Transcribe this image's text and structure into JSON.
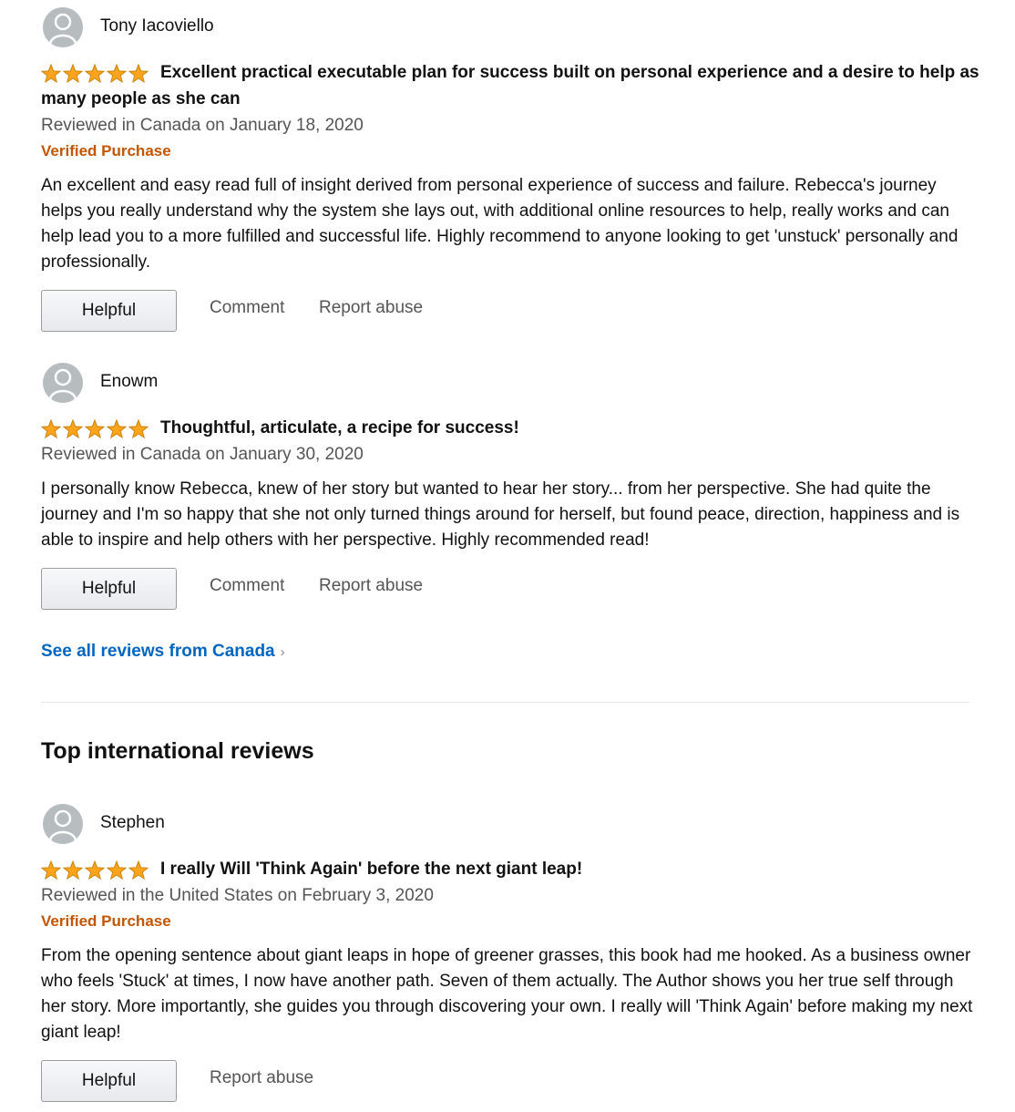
{
  "reviews": [
    {
      "profile_name": "Tony Iacoviello",
      "rating": 5,
      "title": "Excellent practical executable plan for success built on personal experience and a desire to help as many people as she can",
      "date": "Reviewed in Canada on January 18, 2020",
      "verified": "Verified Purchase",
      "body": "An excellent and easy read full of insight derived from personal experience of success and failure. Rebecca's journey helps you really understand why the system she lays out, with additional online resources to help, really works and can help lead you to a more fulfilled and successful life. Highly recommend to anyone looking to get 'unstuck' personally and professionally.",
      "helpful_label": "Helpful",
      "comment_label": "Comment",
      "report_label": "Report abuse"
    },
    {
      "profile_name": "Enowm",
      "rating": 5,
      "title": "Thoughtful, articulate, a recipe for success!",
      "date": "Reviewed in Canada on January 30, 2020",
      "body": "I personally know Rebecca, knew of her story but wanted to hear her story... from her perspective. She had quite the journey and I'm so happy that she not only turned things around for herself, but found peace, direction, happiness and is able to inspire and help others with her perspective. Highly recommended read!",
      "helpful_label": "Helpful",
      "comment_label": "Comment",
      "report_label": "Report abuse"
    },
    {
      "profile_name": "Stephen",
      "rating": 5,
      "title": "I really Will 'Think Again' before the next giant leap!",
      "date": "Reviewed in the United States on February 3, 2020",
      "verified": "Verified Purchase",
      "body": "From the opening sentence about giant leaps in hope of greener grasses, this book had me hooked. As a business owner who feels 'Stuck' at times, I now have another path. Seven of them actually. The Author shows you her true self through her story. More importantly, she guides you through discovering your own. I really will 'Think Again' before making my next giant leap!",
      "helpful_label": "Helpful",
      "report_label": "Report abuse"
    }
  ],
  "see_all_link": "See all reviews from Canada",
  "see_all_chevron": "›",
  "international_heading": "Top international reviews",
  "icons": {
    "avatar": "default-avatar-icon",
    "star": "star-icon"
  },
  "colors": {
    "star": "#ffa41c",
    "verified": "#c45500",
    "link": "#0066c0",
    "muted": "#555555"
  }
}
